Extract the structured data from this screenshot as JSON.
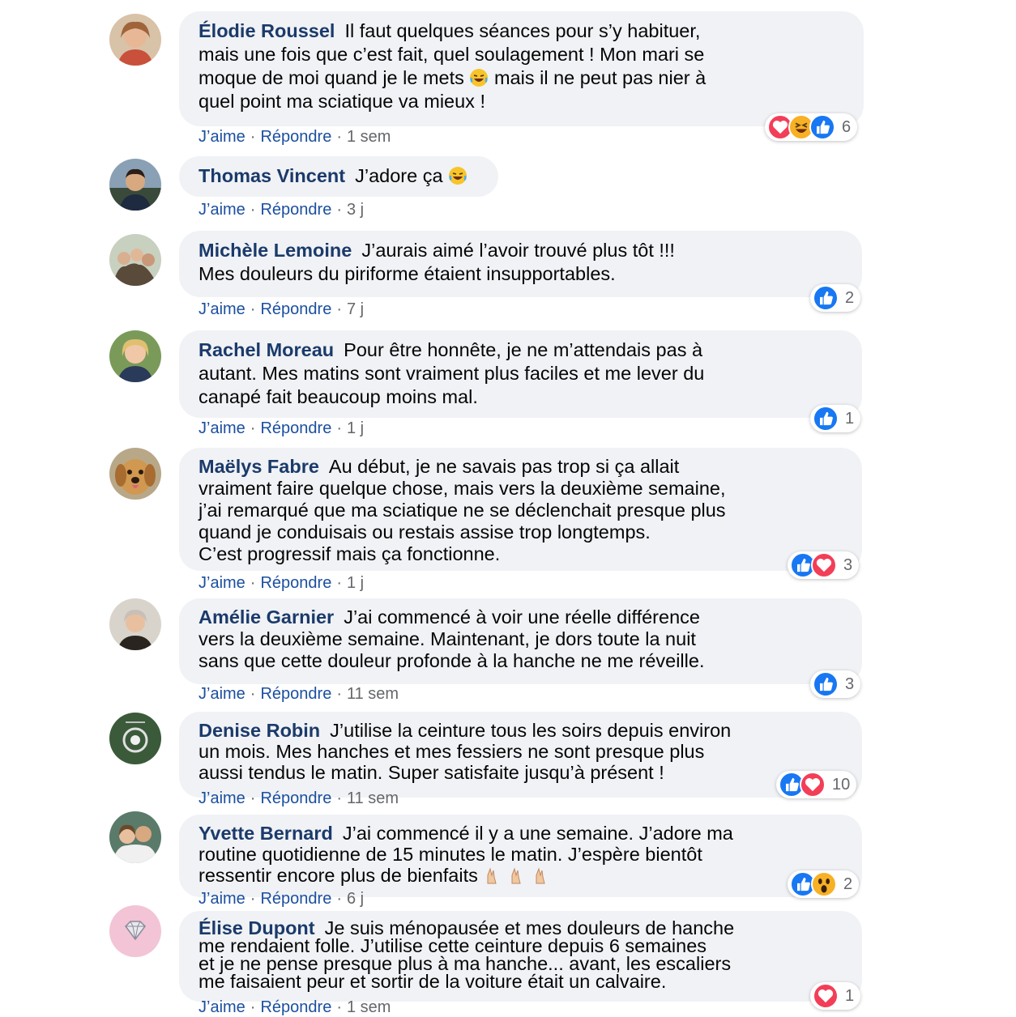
{
  "comments": [
    {
      "name": "Élodie Roussel",
      "text_a": "Il faut quelques séances pour s’y habituer,\nmais une fois que c’est fait, quel soulagement ! Mon mari se\nmoque de moi quand je le mets ",
      "emoji_icon": "laughing-tears-emoji",
      "text_b": " mais il ne peut pas nier à\nquel point ma sciatique va mieux !",
      "like": "J’aime",
      "reply": "Répondre",
      "time": "1 sem",
      "reactions": [
        "love",
        "haha",
        "like"
      ],
      "count": "6",
      "avatar_color": "#c98a5e"
    },
    {
      "name": "Thomas Vincent",
      "text_a": "J’adore ça ",
      "emoji_icon": "laughing-tears-emoji",
      "like": "J’aime",
      "reply": "Répondre",
      "time": "3 j",
      "avatar_color": "#3a5a78"
    },
    {
      "name": "Michèle Lemoine",
      "text_a": "J’aurais aimé l’avoir trouvé plus tôt !!!\nMes douleurs du piriforme étaient insupportables.",
      "like": "J’aime",
      "reply": "Répondre",
      "time": "7 j",
      "reactions": [
        "like"
      ],
      "count": "2",
      "avatar_color": "#8a7a62"
    },
    {
      "name": "Rachel Moreau",
      "text_a": "Pour être honnête, je ne m’attendais pas à\nautant. Mes matins sont vraiment plus faciles et me lever du\ncanapé fait beaucoup moins mal.",
      "like": "J’aime",
      "reply": "Répondre",
      "time": "1 j",
      "reactions": [
        "like"
      ],
      "count": "1",
      "avatar_color": "#6e8a4e"
    },
    {
      "name": "Maëlys Fabre",
      "text_a": "Au début, je ne savais pas trop si ça allait\nvraiment faire quelque chose, mais vers la deuxième semaine,\nj’ai remarqué que ma sciatique ne se déclenchait presque plus\nquand je conduisais ou restais assise trop longtemps.\nC’est progressif mais ça fonctionne.",
      "like": "J’aime",
      "reply": "Répondre",
      "time": "1 j",
      "reactions": [
        "like",
        "love"
      ],
      "count": "3",
      "avatar_color": "#c8944a"
    },
    {
      "name": "Amélie Garnier",
      "text_a": "J’ai commencé à voir une réelle différence\nvers la deuxième semaine. Maintenant, je dors toute la nuit\nsans que cette douleur profonde à la hanche ne me réveille.",
      "like": "J’aime",
      "reply": "Répondre",
      "time": "11 sem",
      "reactions": [
        "like"
      ],
      "count": "3",
      "avatar_color": "#9a8a80"
    },
    {
      "name": "Denise Robin",
      "text_a": "J’utilise la ceinture tous les soirs depuis environ\nun mois. Mes hanches et mes fessiers ne sont presque plus\naussi tendus le matin. Super satisfaite jusqu’à présent !",
      "like": "J’aime",
      "reply": "Répondre",
      "time": "11 sem",
      "reactions": [
        "like",
        "love"
      ],
      "count": "10",
      "avatar_color": "#4e6a52"
    },
    {
      "name": "Yvette Bernard",
      "text_a": "J’ai commencé il y a une semaine. J’adore ma\nroutine quotidienne de 15 minutes le matin. J’espère bientôt\nressentir encore plus de bienfaits ",
      "emoji_icon": "crossed-fingers-emoji",
      "like": "J’aime",
      "reply": "Répondre",
      "time": "6 j",
      "reactions": [
        "like",
        "wow"
      ],
      "count": "2",
      "avatar_color": "#6a8a9a"
    },
    {
      "name": "Élise Dupont",
      "text_a": "Je suis ménopausée et mes douleurs de hanche\nme rendaient folle. J’utilise cette ceinture depuis 6 semaines\net je ne pense presque plus à ma hanche... avant, les escaliers\nme faisaient peur et sortir de la voiture était un calvaire.",
      "like": "J’aime",
      "reply": "Répondre",
      "time": "1 sem",
      "reactions": [
        "love"
      ],
      "count": "1",
      "avatar_color": "#f2c4d6"
    }
  ],
  "colors": {
    "like": "#1877f2",
    "love": "#f33e58",
    "haha": "#f7b125",
    "name": "#1b3a6b"
  }
}
